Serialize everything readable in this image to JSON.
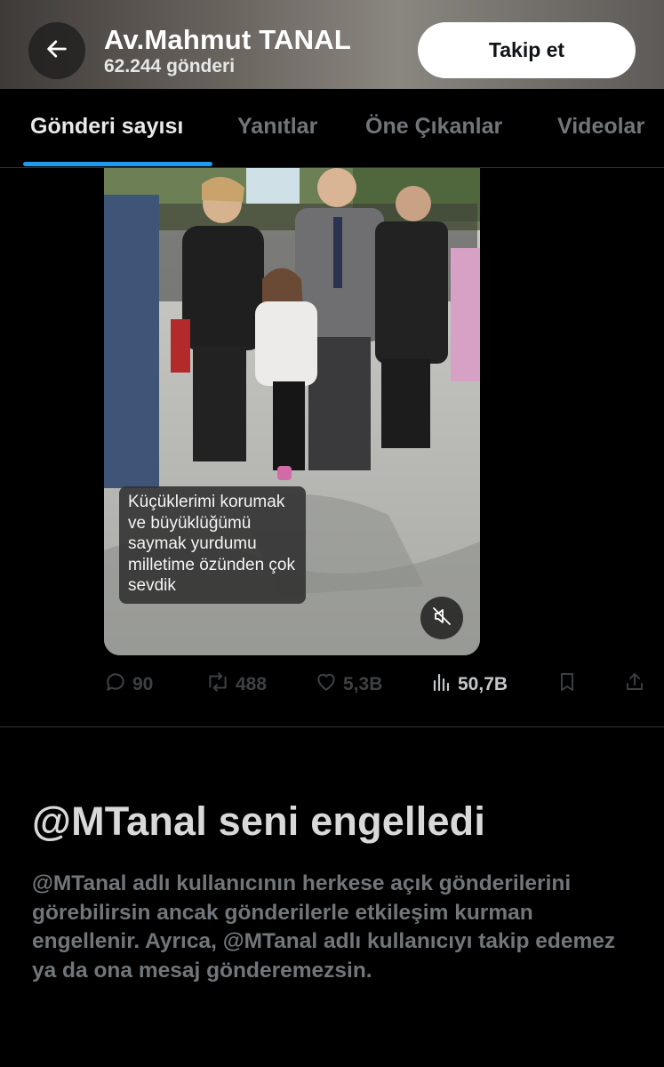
{
  "header": {
    "name": "Av.Mahmut TANAL",
    "post_count": "62.244 gönderi",
    "follow_label": "Takip et"
  },
  "tabs": [
    {
      "label": "Gönderi sayısı",
      "active": true
    },
    {
      "label": "Yanıtlar",
      "active": false
    },
    {
      "label": "Öne Çıkanlar",
      "active": false
    },
    {
      "label": "Videolar",
      "active": false
    }
  ],
  "video": {
    "caption": "Küçüklerimi korumak ve büyüklüğümü saymak yurdumu milletime özünden çok sevdik",
    "muted": true
  },
  "actions": {
    "replies": "90",
    "reposts": "488",
    "likes": "5,3B",
    "views": "50,7B"
  },
  "blocked": {
    "title": "@MTanal seni engelledi",
    "body": "@MTanal adlı kullanıcının herkese açık gönderilerini görebilirsin ancak gönderilerle etkileşim kurman engellenir. Ayrıca, @MTanal adlı kullanıcıyı takip edemez ya da ona mesaj gönderemezsin."
  },
  "colors": {
    "accent": "#1d9bf0",
    "background": "#000000",
    "muted_text": "#71767b"
  }
}
